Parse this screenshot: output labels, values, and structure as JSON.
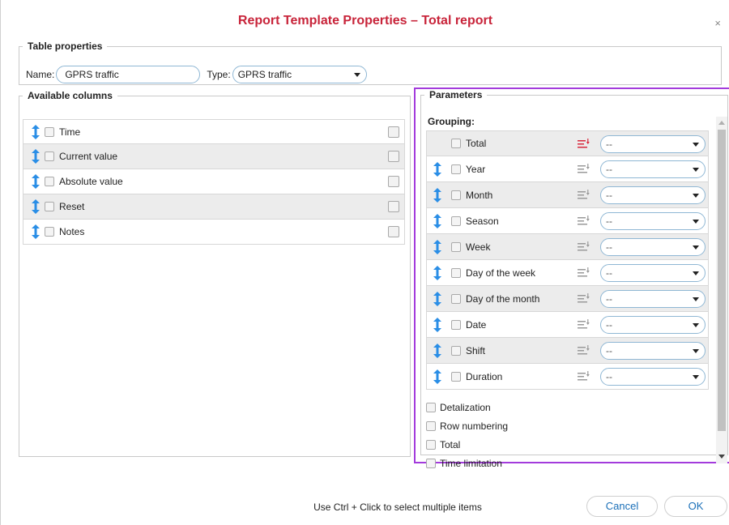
{
  "dialog": {
    "title": "Report Template Properties – Total report",
    "close_glyph": "×"
  },
  "table_properties": {
    "legend": "Table properties",
    "name_label": "Name:",
    "name_value": "GPRS traffic",
    "type_label": "Type:",
    "type_value": "GPRS traffic"
  },
  "available_columns": {
    "legend": "Available columns",
    "items": [
      {
        "label": "Time"
      },
      {
        "label": "Current value"
      },
      {
        "label": "Absolute value"
      },
      {
        "label": "Reset"
      },
      {
        "label": "Notes"
      }
    ]
  },
  "parameters": {
    "legend": "Parameters",
    "grouping_label": "Grouping:",
    "grouping": [
      {
        "label": "Total",
        "value": "--",
        "sort_active": true
      },
      {
        "label": "Year",
        "value": "--"
      },
      {
        "label": "Month",
        "value": "--"
      },
      {
        "label": "Season",
        "value": "--"
      },
      {
        "label": "Week",
        "value": "--"
      },
      {
        "label": "Day of the week",
        "value": "--"
      },
      {
        "label": "Day of the month",
        "value": "--"
      },
      {
        "label": "Date",
        "value": "--"
      },
      {
        "label": "Shift",
        "value": "--"
      },
      {
        "label": "Duration",
        "value": "--"
      }
    ],
    "options": [
      {
        "label": "Detalization"
      },
      {
        "label": "Row numbering"
      },
      {
        "label": "Total"
      },
      {
        "label": "Time limitation"
      }
    ]
  },
  "footer": {
    "hint": "Use Ctrl + Click to select multiple items",
    "cancel_label": "Cancel",
    "ok_label": "OK"
  },
  "colors": {
    "title": "#c8243a",
    "drag_icon": "#2a8ee6",
    "sort_active": "#d8283d",
    "selection_outline": "#a33bdc",
    "button_text": "#1a6fb8"
  },
  "icons": {
    "drag": "updown-arrow-icon",
    "info": "info-icon",
    "sort": "sort-icon"
  }
}
